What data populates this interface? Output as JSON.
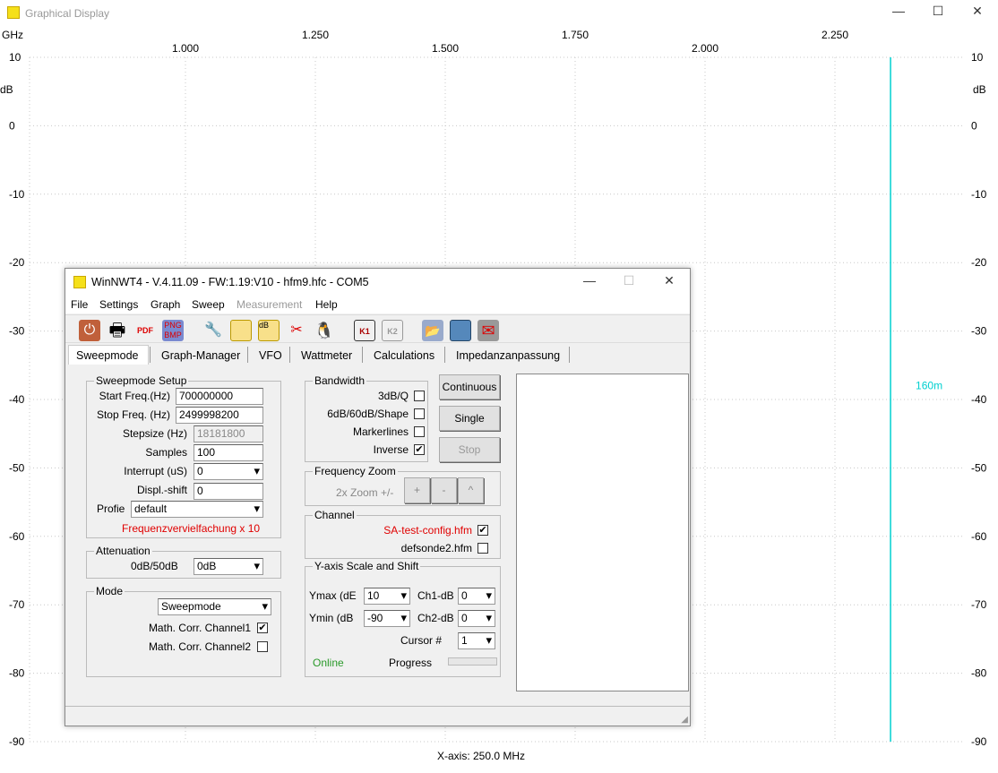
{
  "window": {
    "title": "Graphical Display",
    "icon": "sweep-icon"
  },
  "chart_data": {
    "type": "line",
    "xlabel": "GHz",
    "ylabel": "dB",
    "xlim": [
      0.7,
      2.5
    ],
    "ylim": [
      -90,
      10
    ],
    "x_ticks": [
      "1.000",
      "1.250",
      "1.500",
      "1.750",
      "2.000",
      "2.250"
    ],
    "x_tick_values": [
      1.0,
      1.25,
      1.5,
      1.75,
      2.0,
      2.25
    ],
    "y_ticks": [
      "10",
      "0",
      "-10",
      "-20",
      "-30",
      "-40",
      "-50",
      "-60",
      "-70",
      "-80",
      "-90"
    ],
    "y_tick_values": [
      10,
      0,
      -10,
      -20,
      -30,
      -40,
      -50,
      -60,
      -70,
      -80,
      -90
    ],
    "grid": true,
    "cursor": {
      "x": 2.357,
      "label": "160m",
      "color": "#00d0d0"
    },
    "footer": "X-axis: 250.0 MHz"
  },
  "dialog": {
    "title": "WinNWT4 - V.4.11.09 - FW:1.19:V10 - hfm9.hfc - COM5",
    "menu": [
      "File",
      "Settings",
      "Graph",
      "Sweep",
      "Measurement",
      "Help"
    ],
    "tabs": [
      "Sweepmode",
      "Graph-Manager",
      "VFO",
      "Wattmeter",
      "Calculations",
      "Impedanzanpassung"
    ],
    "setup": {
      "legend": "Sweepmode Setup",
      "start_label": "Start Freq.(Hz)",
      "start": "700000000",
      "stop_label": "Stop Freq. (Hz)",
      "stop": "2499998200",
      "step_label": "Stepsize (Hz)",
      "step": "18181800",
      "samples_label": "Samples",
      "samples": "100",
      "interrupt_label": "Interrupt (uS)",
      "interrupt": "0",
      "shift_label": "Displ.-shift",
      "shift": "0",
      "profile_label": "Profie",
      "profile": "default",
      "note": "Frequenzvervielfachung x 10"
    },
    "atten": {
      "legend": "Attenuation",
      "label": "0dB/50dB",
      "value": "0dB"
    },
    "mode": {
      "legend": "Mode",
      "value": "Sweepmode",
      "corr1": "Math. Corr. Channel1",
      "corr1_checked": true,
      "corr2": "Math. Corr. Channel2",
      "corr2_checked": false
    },
    "bandwidth": {
      "legend": "Bandwidth",
      "items": [
        {
          "label": "3dB/Q",
          "checked": false
        },
        {
          "label": "6dB/60dB/Shape",
          "checked": false
        },
        {
          "label": "Markerlines",
          "checked": false
        },
        {
          "label": "Inverse",
          "checked": true
        }
      ]
    },
    "buttons": {
      "continuous": "Continuous",
      "single": "Single",
      "stop": "Stop"
    },
    "zoom": {
      "legend": "Frequency Zoom",
      "label": "2x Zoom +/-",
      "plus": "+",
      "minus": "-",
      "up": "^"
    },
    "channel": {
      "legend": "Channel",
      "ch1": "SA-test-config.hfm",
      "ch1_checked": true,
      "ch2": "defsonde2.hfm",
      "ch2_checked": false
    },
    "yaxis": {
      "legend": "Y-axis Scale and Shift",
      "ymax_label": "Ymax (dE",
      "ymax": "10",
      "ymin_label": "Ymin (dB",
      "ymin": "-90",
      "ch1_label": "Ch1-dB",
      "ch1": "0",
      "ch2_label": "Ch2-dB",
      "ch2": "0",
      "cursor_label": "Cursor #",
      "cursor": "1",
      "status": "Online",
      "progress_label": "Progress",
      "progress": 0
    }
  }
}
